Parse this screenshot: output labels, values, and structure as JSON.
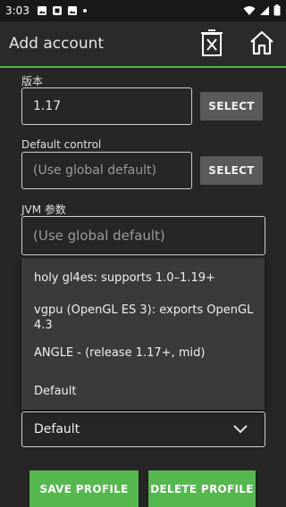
{
  "status_bar": {
    "time": "3:03",
    "icons": [
      "photo-icon",
      "notification-icon",
      "photo-icon",
      "dot-icon"
    ],
    "right_icons": [
      "wifi-icon",
      "signal-icon",
      "battery-icon"
    ]
  },
  "app_bar": {
    "title": "Add account",
    "buttons": [
      "delete-icon",
      "home-icon"
    ],
    "divider_color": "#55b84f"
  },
  "form": {
    "version_label": "版本",
    "version_value": "1.17",
    "version_select": "SELECT",
    "control_label": "Default control",
    "control_placeholder": "(Use global default)",
    "control_select": "SELECT",
    "jvm_label": "JVM 参数",
    "jvm_placeholder": "(Use global default)"
  },
  "renderer_dropdown": {
    "options": [
      "holy gl4es: supports 1.0–1.19+",
      "vgpu (OpenGL ES 3): exports OpenGL 4.3",
      "ANGLE - (release 1.17+, mid)",
      "Default"
    ],
    "selected": "Default"
  },
  "actions": {
    "save": "SAVE PROFILE",
    "delete": "DELETE PROFILE"
  },
  "colors": {
    "accent": "#55b84f",
    "background": "#262626",
    "button_gray": "#5a5a5a"
  }
}
